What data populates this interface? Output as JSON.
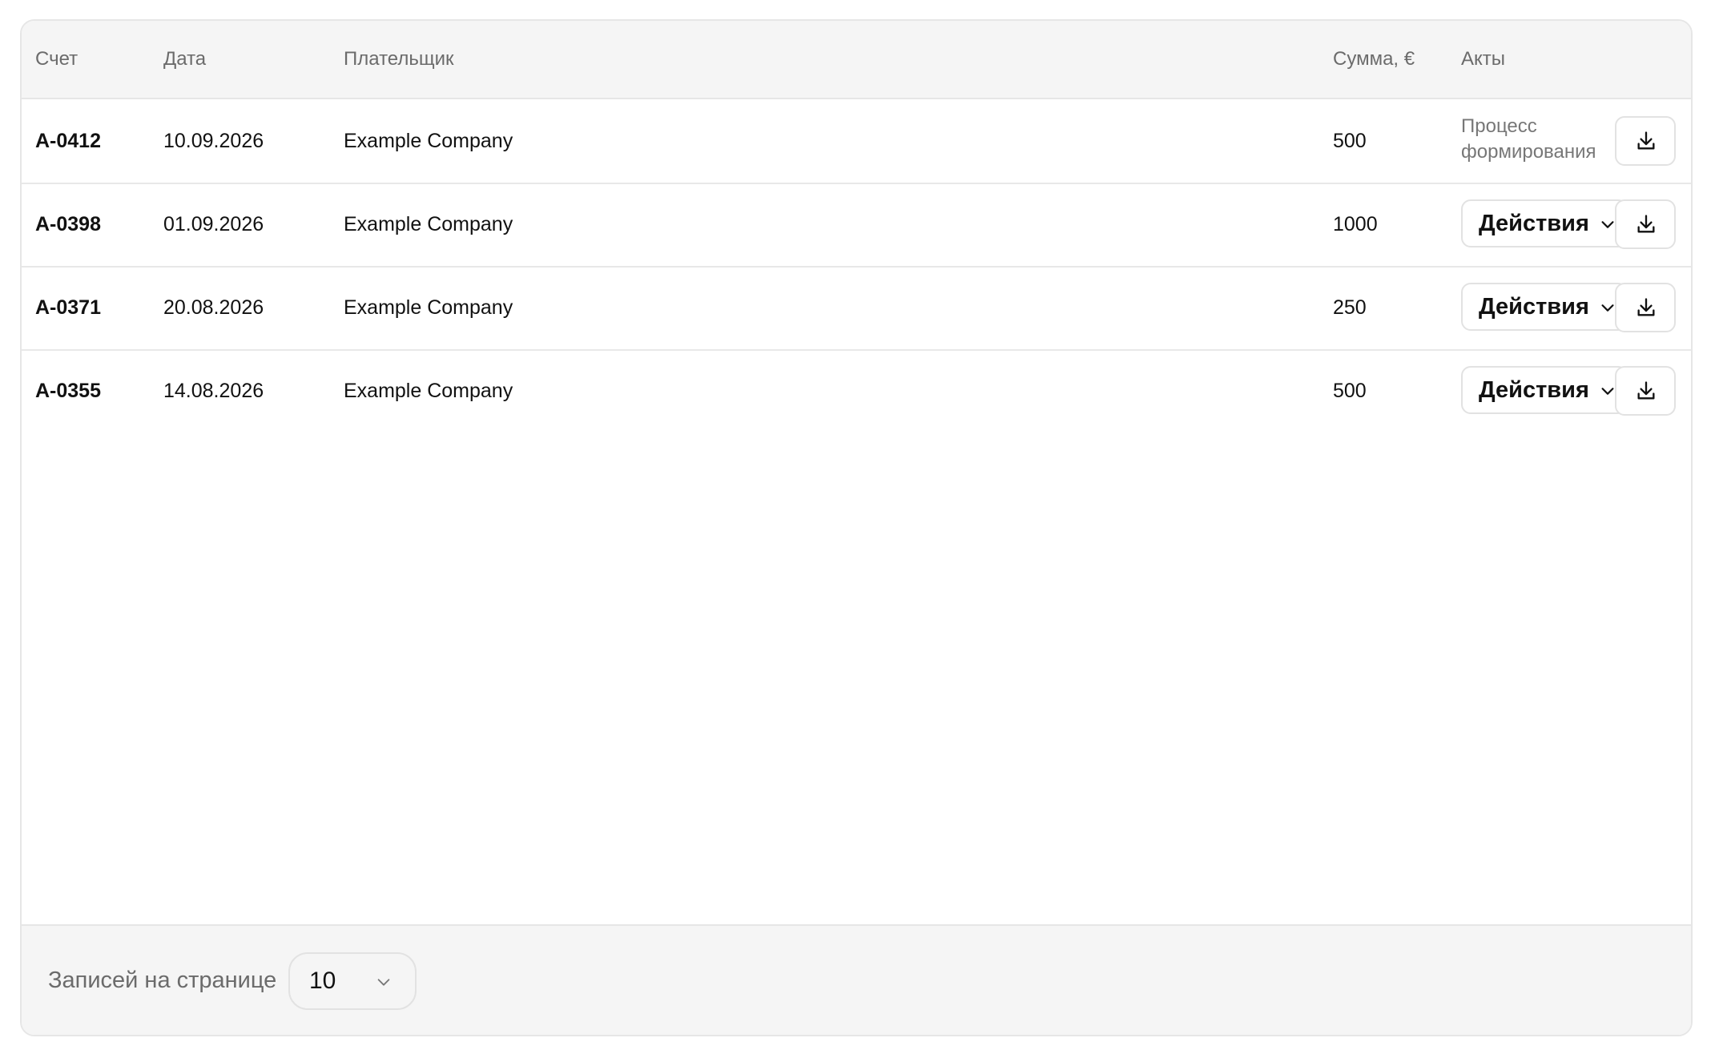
{
  "table": {
    "headers": {
      "invoice": "Счет",
      "date": "Дата",
      "payer": "Плательщик",
      "sum": "Сумма, €",
      "acts": "Акты"
    },
    "rows": [
      {
        "invoice": "A-0412",
        "date": "10.09.2026",
        "payer": "Example Company",
        "sum": "500",
        "status": "Процесс формирования"
      },
      {
        "invoice": "A-0398",
        "date": "01.09.2026",
        "payer": "Example Company",
        "sum": "1000",
        "actions_label": "Действия"
      },
      {
        "invoice": "A-0371",
        "date": "20.08.2026",
        "payer": "Example Company",
        "sum": "250",
        "actions_label": "Действия"
      },
      {
        "invoice": "A-0355",
        "date": "14.08.2026",
        "payer": "Example Company",
        "sum": "500",
        "actions_label": "Действия"
      }
    ]
  },
  "footer": {
    "page_size_label": "Записей на странице",
    "page_size_value": "10"
  },
  "icons": {
    "download": "download-icon",
    "chevron": "chevron-down-icon"
  }
}
